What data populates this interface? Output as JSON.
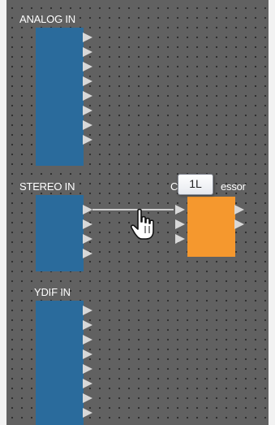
{
  "canvas": {
    "blocks": [
      {
        "label": "ANALOG IN",
        "type": "input"
      },
      {
        "label": "STEREO IN",
        "type": "input"
      },
      {
        "label": "YDIF IN",
        "type": "input"
      }
    ],
    "processor": {
      "label": "Compressor",
      "visible_label_fragment_left": "C",
      "visible_label_fragment_right": "essor"
    },
    "tooltip": "1L",
    "cursor": "hand-pointer-icon",
    "colors": {
      "background": "#616161",
      "input_block": "#2a6b9c",
      "processor_block": "#f5982e",
      "port": "#d8d8d8"
    }
  }
}
